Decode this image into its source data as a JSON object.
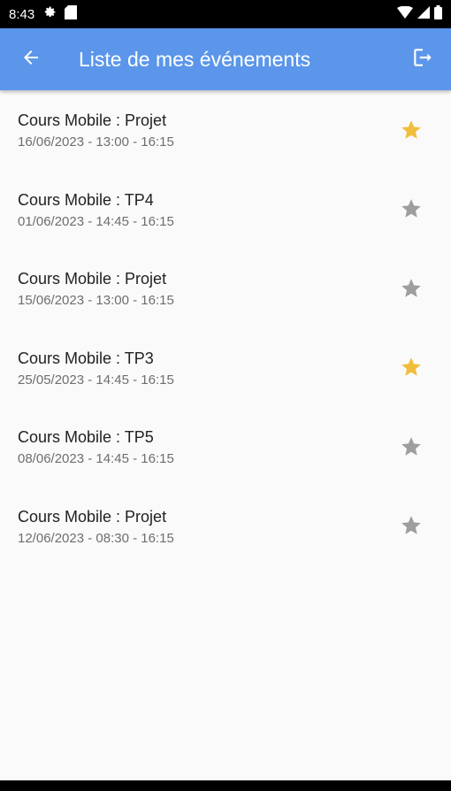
{
  "status_bar": {
    "time": "8:43",
    "icons": [
      "settings-gear-icon",
      "sd-card-icon",
      "wifi-icon",
      "signal-icon",
      "battery-icon"
    ]
  },
  "app_bar": {
    "title": "Liste de mes événements",
    "back_icon": "arrow-left-icon",
    "logout_icon": "logout-icon",
    "color": "#5b96ea"
  },
  "colors": {
    "star_active": "#f0be3c",
    "star_inactive": "#9e9e9e"
  },
  "events": [
    {
      "title": "Cours Mobile : Projet",
      "subtitle": "16/06/2023 - 13:00 - 16:15",
      "favorite": true
    },
    {
      "title": "Cours Mobile : TP4",
      "subtitle": "01/06/2023 - 14:45 - 16:15",
      "favorite": false
    },
    {
      "title": "Cours Mobile : Projet",
      "subtitle": "15/06/2023 - 13:00 - 16:15",
      "favorite": false
    },
    {
      "title": "Cours Mobile : TP3",
      "subtitle": "25/05/2023 - 14:45 - 16:15",
      "favorite": true
    },
    {
      "title": "Cours Mobile : TP5",
      "subtitle": "08/06/2023 - 14:45 - 16:15",
      "favorite": false
    },
    {
      "title": "Cours Mobile : Projet",
      "subtitle": "12/06/2023 - 08:30 - 16:15",
      "favorite": false
    }
  ]
}
